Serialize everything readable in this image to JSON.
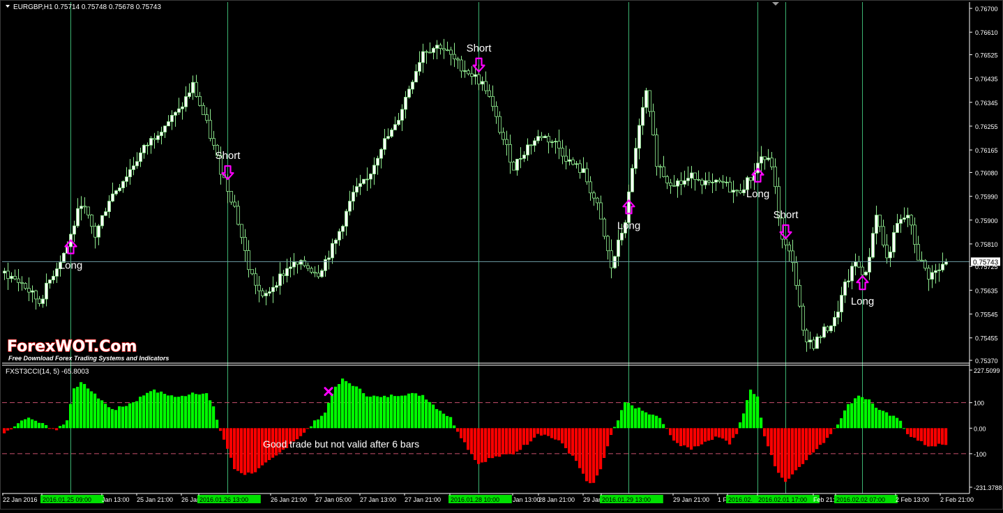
{
  "main_chart": {
    "header": {
      "symbol_tf": "EURGBP,H1",
      "ohlc": "0.75714 0.75748 0.75678 0.75743"
    },
    "current_price_label": "0.75743",
    "annotations": [
      {
        "text": "Long",
        "dir": "up",
        "bar": 19
      },
      {
        "text": "Short",
        "dir": "down",
        "bar": 64
      },
      {
        "text": "Short",
        "dir": "down",
        "bar": 136
      },
      {
        "text": "Long",
        "dir": "up",
        "bar": 179
      },
      {
        "text": "Long",
        "dir": "up",
        "bar": 216
      },
      {
        "text": "Short",
        "dir": "down",
        "bar": 224
      },
      {
        "text": "Long",
        "dir": "up",
        "bar": 246
      }
    ]
  },
  "watermark": {
    "title": "ForexWOT.Com",
    "subtitle": "Free Download Forex Trading Systems and Indicators"
  },
  "indicator": {
    "label": "FXST3CCI(14, 5) -65.8003",
    "comment": "Good trade but not valid after 6 bars",
    "levels": [
      100,
      -100
    ],
    "marker_bar": 93,
    "marker_color": "#ff00ff"
  },
  "time_axis": {
    "labels": [
      {
        "text": "22 Jan 2016",
        "highlight": false
      },
      {
        "text": "2016.01.25 09:00",
        "highlight": true
      },
      {
        "text": "Jan 13:00",
        "highlight": false
      },
      {
        "text": "25 Jan 21:00",
        "highlight": false
      },
      {
        "text": "26 Jan",
        "highlight": false
      },
      {
        "text": "2016.01.26 13:00",
        "highlight": true
      },
      {
        "text": "26 Jan 21:00",
        "highlight": false
      },
      {
        "text": "27 Jan 05:00",
        "highlight": false
      },
      {
        "text": "27 Jan 13:00",
        "highlight": false
      },
      {
        "text": "27 Jan 21:00",
        "highlight": false
      },
      {
        "text": "2016.01.28 10:00",
        "highlight": true
      },
      {
        "text": "Jan 13:00",
        "highlight": false
      },
      {
        "text": "28 Jan 21:00",
        "highlight": false
      },
      {
        "text": "29 Jan",
        "highlight": false
      },
      {
        "text": "2016.01.29 13:00",
        "highlight": true
      },
      {
        "text": "29 Jan 21:00",
        "highlight": false
      },
      {
        "text": "1 Feb",
        "highlight": false
      },
      {
        "text": "2016.02.",
        "highlight": true
      },
      {
        "text": "2016.02.01 17:00",
        "highlight": true
      },
      {
        "text": "Feb 21:",
        "highlight": false
      },
      {
        "text": "2016.02.02 07:00",
        "highlight": true
      },
      {
        "text": "2 Feb 13:00",
        "highlight": false
      },
      {
        "text": "2 Feb 21:00",
        "highlight": false
      }
    ]
  },
  "colors": {
    "background": "#000000",
    "bull_candle": "#ffffff",
    "candle_outline": "#90ee90",
    "grid_vline": "#3cb371",
    "bar_positive": "#00ff00",
    "bar_negative": "#ff0000",
    "level_line": "#c8506e",
    "arrow": "#ff00ff",
    "label_highlight": "#00e000"
  },
  "chart_data": [
    {
      "type": "candlestick",
      "title": "EURGBP,H1",
      "ylim": [
        0.7537,
        0.767
      ],
      "y_ticks": [
        "0.76700",
        "0.76610",
        "0.76525",
        "0.76435",
        "0.76345",
        "0.76255",
        "0.76165",
        "0.76080",
        "0.75990",
        "0.75900",
        "0.75810",
        "0.75725",
        "0.75635",
        "0.75545",
        "0.75455",
        "0.75370"
      ],
      "current_price": 0.75743,
      "event_lines": [
        "2016.01.25 09:00",
        "2016.01.26 13:00",
        "2016.01.28 10:00",
        "2016.01.29 13:00",
        "2016.02.01 09:00",
        "2016.02.01 17:00",
        "2016.02.02 07:00"
      ],
      "close_anchors": [
        [
          0,
          0.757
        ],
        [
          5,
          0.7566
        ],
        [
          10,
          0.7559
        ],
        [
          14,
          0.757
        ],
        [
          18,
          0.758
        ],
        [
          22,
          0.7597
        ],
        [
          26,
          0.7584
        ],
        [
          30,
          0.7598
        ],
        [
          35,
          0.7607
        ],
        [
          40,
          0.7617
        ],
        [
          45,
          0.7625
        ],
        [
          50,
          0.7631
        ],
        [
          54,
          0.7641
        ],
        [
          58,
          0.7626
        ],
        [
          62,
          0.7609
        ],
        [
          66,
          0.7595
        ],
        [
          70,
          0.7572
        ],
        [
          74,
          0.756
        ],
        [
          78,
          0.7567
        ],
        [
          82,
          0.7573
        ],
        [
          86,
          0.7573
        ],
        [
          90,
          0.757
        ],
        [
          95,
          0.7582
        ],
        [
          100,
          0.76
        ],
        [
          104,
          0.7605
        ],
        [
          108,
          0.7618
        ],
        [
          112,
          0.7625
        ],
        [
          116,
          0.764
        ],
        [
          120,
          0.7654
        ],
        [
          125,
          0.7656
        ],
        [
          130,
          0.7649
        ],
        [
          135,
          0.7644
        ],
        [
          138,
          0.764
        ],
        [
          142,
          0.7624
        ],
        [
          146,
          0.761
        ],
        [
          150,
          0.7618
        ],
        [
          154,
          0.7622
        ],
        [
          158,
          0.7619
        ],
        [
          162,
          0.7612
        ],
        [
          166,
          0.7608
        ],
        [
          170,
          0.7595
        ],
        [
          174,
          0.7572
        ],
        [
          178,
          0.759
        ],
        [
          181,
          0.7618
        ],
        [
          184,
          0.7638
        ],
        [
          187,
          0.7612
        ],
        [
          190,
          0.7605
        ],
        [
          194,
          0.7604
        ],
        [
          198,
          0.7607
        ],
        [
          202,
          0.7603
        ],
        [
          206,
          0.7604
        ],
        [
          210,
          0.76
        ],
        [
          214,
          0.7606
        ],
        [
          217,
          0.7614
        ],
        [
          220,
          0.7611
        ],
        [
          223,
          0.7582
        ],
        [
          226,
          0.7575
        ],
        [
          229,
          0.7547
        ],
        [
          232,
          0.7543
        ],
        [
          235,
          0.7548
        ],
        [
          238,
          0.7552
        ],
        [
          241,
          0.7565
        ],
        [
          244,
          0.7574
        ],
        [
          247,
          0.7569
        ],
        [
          250,
          0.7593
        ],
        [
          253,
          0.7575
        ],
        [
          256,
          0.7588
        ],
        [
          259,
          0.7592
        ],
        [
          262,
          0.7576
        ],
        [
          265,
          0.7569
        ],
        [
          268,
          0.7571
        ],
        [
          270,
          0.7574
        ]
      ]
    },
    {
      "type": "bar",
      "title": "FXST3CCI(14, 5)",
      "ylim": [
        -231.3788,
        227.5099
      ],
      "y_ticks": [
        "227.5099",
        "100",
        "0.00",
        "-100",
        "-231.3788"
      ],
      "last_value": -65.8003,
      "anchors": [
        [
          0,
          -20
        ],
        [
          3,
          10
        ],
        [
          6,
          40
        ],
        [
          9,
          30
        ],
        [
          12,
          10
        ],
        [
          15,
          -5
        ],
        [
          18,
          30
        ],
        [
          20,
          160
        ],
        [
          22,
          175
        ],
        [
          24,
          160
        ],
        [
          26,
          130
        ],
        [
          28,
          110
        ],
        [
          30,
          80
        ],
        [
          32,
          75
        ],
        [
          35,
          90
        ],
        [
          38,
          110
        ],
        [
          42,
          150
        ],
        [
          46,
          135
        ],
        [
          50,
          120
        ],
        [
          54,
          140
        ],
        [
          58,
          135
        ],
        [
          60,
          80
        ],
        [
          62,
          -10
        ],
        [
          64,
          -80
        ],
        [
          66,
          -160
        ],
        [
          69,
          -180
        ],
        [
          72,
          -170
        ],
        [
          75,
          -140
        ],
        [
          78,
          -110
        ],
        [
          82,
          -60
        ],
        [
          86,
          -20
        ],
        [
          88,
          10
        ],
        [
          90,
          40
        ],
        [
          92,
          60
        ],
        [
          94,
          140
        ],
        [
          97,
          190
        ],
        [
          100,
          170
        ],
        [
          104,
          130
        ],
        [
          108,
          120
        ],
        [
          112,
          130
        ],
        [
          116,
          135
        ],
        [
          120,
          130
        ],
        [
          124,
          80
        ],
        [
          128,
          40
        ],
        [
          130,
          -10
        ],
        [
          133,
          -80
        ],
        [
          136,
          -140
        ],
        [
          139,
          -120
        ],
        [
          142,
          -110
        ],
        [
          146,
          -100
        ],
        [
          150,
          -60
        ],
        [
          153,
          -20
        ],
        [
          156,
          -30
        ],
        [
          160,
          -60
        ],
        [
          164,
          -130
        ],
        [
          167,
          -210
        ],
        [
          169,
          -220
        ],
        [
          171,
          -160
        ],
        [
          174,
          -30
        ],
        [
          176,
          30
        ],
        [
          178,
          100
        ],
        [
          180,
          90
        ],
        [
          184,
          60
        ],
        [
          188,
          40
        ],
        [
          191,
          -30
        ],
        [
          194,
          -70
        ],
        [
          197,
          -80
        ],
        [
          200,
          -60
        ],
        [
          203,
          -40
        ],
        [
          206,
          -35
        ],
        [
          208,
          -60
        ],
        [
          210,
          -20
        ],
        [
          212,
          60
        ],
        [
          214,
          150
        ],
        [
          216,
          120
        ],
        [
          218,
          -30
        ],
        [
          221,
          -150
        ],
        [
          224,
          -210
        ],
        [
          226,
          -180
        ],
        [
          230,
          -120
        ],
        [
          234,
          -70
        ],
        [
          237,
          -20
        ],
        [
          239,
          20
        ],
        [
          242,
          90
        ],
        [
          245,
          130
        ],
        [
          248,
          110
        ],
        [
          251,
          70
        ],
        [
          254,
          50
        ],
        [
          257,
          30
        ],
        [
          259,
          -20
        ],
        [
          262,
          -50
        ],
        [
          265,
          -70
        ],
        [
          268,
          -66
        ],
        [
          270,
          -66
        ]
      ]
    }
  ]
}
